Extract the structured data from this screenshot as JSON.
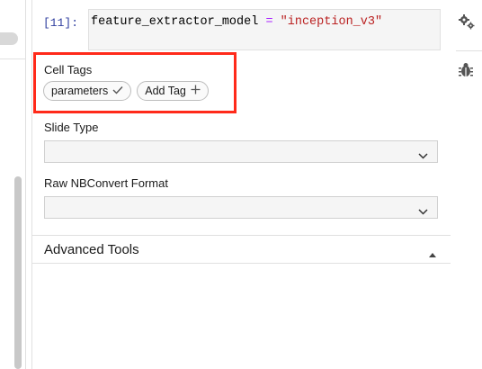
{
  "cell": {
    "prompt": "[11]:",
    "code_var": "feature_extractor_model",
    "code_op": " = ",
    "code_str": "\"inception_v3\""
  },
  "cell_tags": {
    "label": "Cell Tags",
    "tags": [
      {
        "label": "parameters",
        "icon": "check-icon"
      },
      {
        "label": "Add Tag",
        "icon": "plus-icon"
      }
    ]
  },
  "slide_type": {
    "label": "Slide Type",
    "value": ""
  },
  "raw_format": {
    "label": "Raw NBConvert Format",
    "value": ""
  },
  "advanced_tools": {
    "label": "Advanced Tools",
    "state": "expanded"
  },
  "right_sidebar": {
    "icons": [
      "gears-icon",
      "debugger-bug-icon"
    ]
  },
  "colors": {
    "highlight": "#ff2a1a",
    "prompt": "#303f9f",
    "operator": "#aa22ff",
    "string": "#ba2121"
  }
}
